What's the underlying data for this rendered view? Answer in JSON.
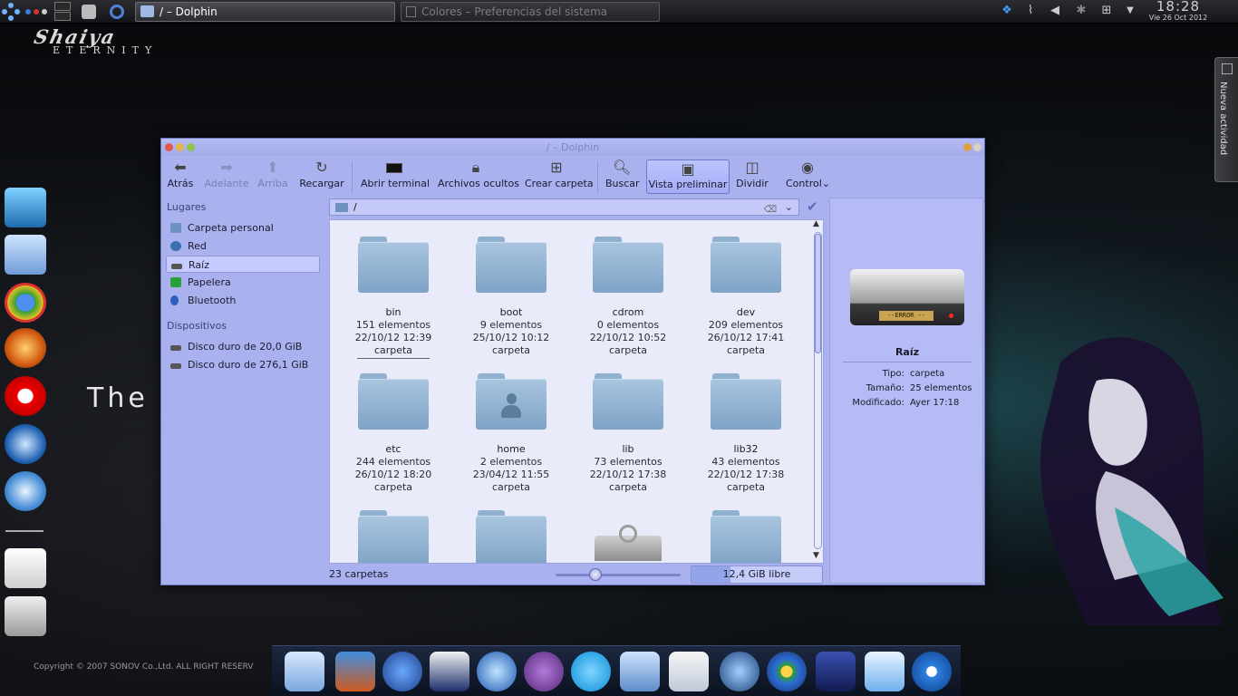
{
  "top_panel": {
    "task_active": "/ – Dolphin",
    "task_inactive": "Colores – Preferencias del sistema",
    "clock_time": "18:28",
    "clock_date": "Vie 26 Oct 2012"
  },
  "desktop": {
    "brand_title": "Shaiya",
    "brand_sub": "ETERNITY",
    "the_text": "The",
    "copyright": "Copyright © 2007 SONOV Co.,Ltd. ALL RIGHT RESERV",
    "activity_label": "Nueva actividad"
  },
  "window": {
    "title": "/ – Dolphin",
    "toolbar": {
      "back": "Atrás",
      "forward": "Adelante",
      "up": "Arriba",
      "reload": "Recargar",
      "terminal": "Abrir terminal",
      "hidden": "Archivos ocultos",
      "new_folder": "Crear carpeta",
      "search": "Buscar",
      "preview": "Vista preliminar",
      "split": "Dividir",
      "control": "Control"
    },
    "places": {
      "heading": "Lugares",
      "items": [
        {
          "label": "Carpeta personal"
        },
        {
          "label": "Red"
        },
        {
          "label": "Raíz"
        },
        {
          "label": "Papelera"
        },
        {
          "label": "Bluetooth"
        }
      ],
      "devices_heading": "Dispositivos",
      "devices": [
        {
          "label": "Disco duro de 20,0 GiB"
        },
        {
          "label": "Disco duro de 276,1 GiB"
        }
      ]
    },
    "url": "/",
    "items": [
      {
        "name": "bin",
        "count": "151 elementos",
        "date": "22/10/12 12:39",
        "type": "carpeta"
      },
      {
        "name": "boot",
        "count": "9 elementos",
        "date": "25/10/12 10:12",
        "type": "carpeta"
      },
      {
        "name": "cdrom",
        "count": "0 elementos",
        "date": "22/10/12 10:52",
        "type": "carpeta"
      },
      {
        "name": "dev",
        "count": "209 elementos",
        "date": "26/10/12 17:41",
        "type": "carpeta"
      },
      {
        "name": "etc",
        "count": "244 elementos",
        "date": "26/10/12 18:20",
        "type": "carpeta"
      },
      {
        "name": "home",
        "count": "2 elementos",
        "date": "23/04/12 11:55",
        "type": "carpeta"
      },
      {
        "name": "lib",
        "count": "73 elementos",
        "date": "22/10/12 17:38",
        "type": "carpeta"
      },
      {
        "name": "lib32",
        "count": "43 elementos",
        "date": "22/10/12 17:38",
        "type": "carpeta"
      }
    ],
    "info": {
      "name": "Raíz",
      "type_key": "Tipo:",
      "type_val": "carpeta",
      "size_key": "Tamaño:",
      "size_val": "25 elementos",
      "mod_key": "Modificado:",
      "mod_val": "Ayer 17:18",
      "drive_label": "--ERROR --"
    },
    "status": {
      "count": "23 carpetas",
      "zoom_level": 0.3,
      "free": "12,4 GiB libre",
      "used_fraction": 0.3
    }
  },
  "colors": {
    "window_bg": "#a9b1ee",
    "view_bg": "#eaebfa",
    "folder": "#8fb0cf"
  }
}
